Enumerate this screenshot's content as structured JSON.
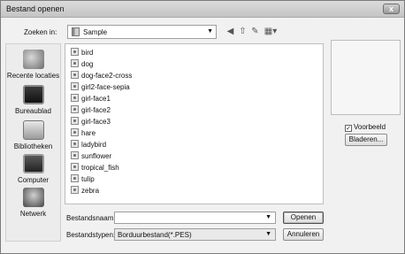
{
  "window": {
    "title": "Bestand openen",
    "close_glyph": "x"
  },
  "toolbar": {
    "look_in_label": "Zoeken in:",
    "look_in_value": "Sample",
    "icons": [
      "back-icon",
      "up-folder-icon",
      "new-folder-icon",
      "view-menu-icon"
    ]
  },
  "places": [
    {
      "label": "Recente locaties",
      "icon": "recent-places-icon"
    },
    {
      "label": "Bureaublad",
      "icon": "desktop-icon"
    },
    {
      "label": "Bibliotheken",
      "icon": "libraries-icon"
    },
    {
      "label": "Computer",
      "icon": "computer-icon"
    },
    {
      "label": "Netwerk",
      "icon": "network-icon"
    }
  ],
  "files": [
    "bird",
    "dog",
    "dog-face2-cross",
    "girl2-face-sepia",
    "girl-face1",
    "girl-face2",
    "girl-face3",
    "hare",
    "ladybird",
    "sunflower",
    "tropical_fish",
    "tulip",
    "zebra"
  ],
  "preview": {
    "checkbox_label": "Voorbeeld",
    "checked": true,
    "browse_label": "Bladeren..."
  },
  "form": {
    "filename_label": "Bestandsnaam:",
    "filename_value": "",
    "filetype_label": "Bestandstypen:",
    "filetype_value": "Borduurbestand(*.PES)",
    "open_label": "Openen",
    "cancel_label": "Annuleren"
  }
}
